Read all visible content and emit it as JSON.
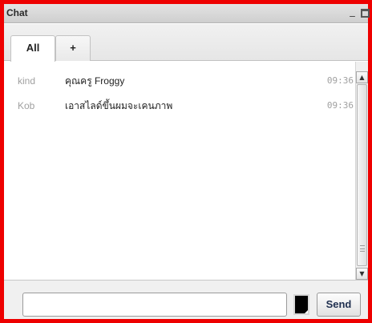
{
  "window": {
    "title": "Chat",
    "minimize_glyph": "_",
    "frame_color": "#ee0000"
  },
  "tabs": [
    {
      "label": "All",
      "active": true
    },
    {
      "label": "+",
      "active": false
    }
  ],
  "messages": [
    {
      "user": "kind",
      "text": "คุณครู Froggy",
      "time": "09:36"
    },
    {
      "user": "Kob",
      "text": "เอาสไลด์ขึ้นผมจะเคนภาพ",
      "time": "09:36"
    }
  ],
  "scrollbar": {
    "up_icon": "▲",
    "down_icon": "▼"
  },
  "composer": {
    "input_value": "",
    "input_placeholder": "",
    "text_color": "#000000",
    "send_label": "Send"
  }
}
